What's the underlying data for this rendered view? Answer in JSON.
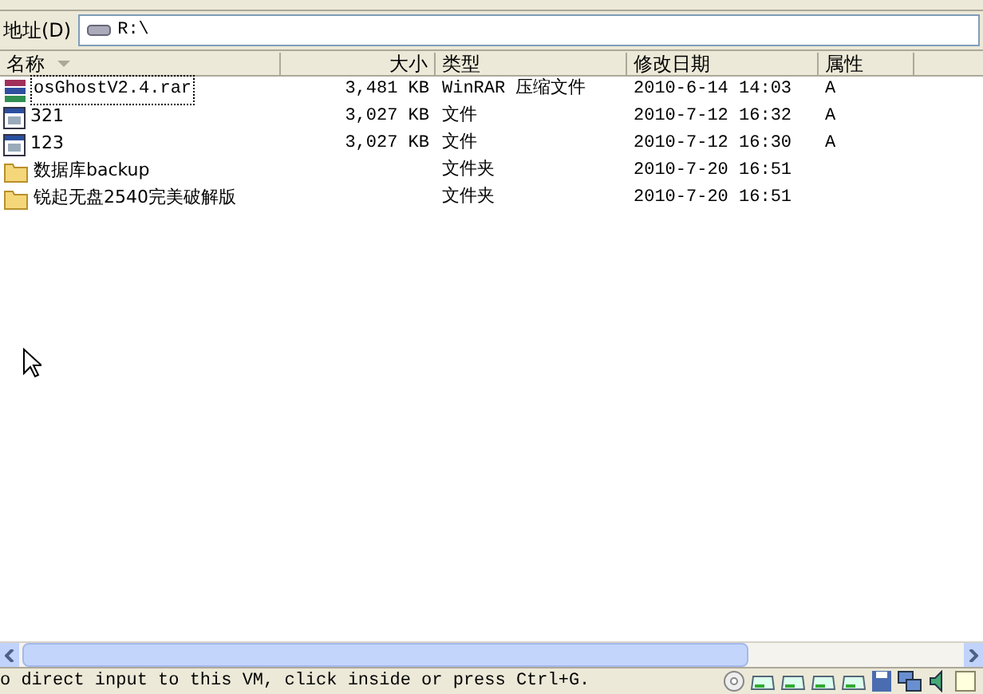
{
  "address_bar": {
    "label": "地址(D)",
    "value": "R:\\"
  },
  "columns": [
    {
      "label": "名称",
      "sorted": true
    },
    {
      "label": "大小",
      "sorted": false
    },
    {
      "label": "类型",
      "sorted": false
    },
    {
      "label": "修改日期",
      "sorted": false
    },
    {
      "label": "属性",
      "sorted": false
    }
  ],
  "rows": [
    {
      "kind": "archive",
      "focused": true,
      "name": "osGhostV2.4.rar",
      "size": "3,481 KB",
      "type": "WinRAR 压缩文件",
      "modified": "2010-6-14 14:03",
      "attributes": "A"
    },
    {
      "kind": "file",
      "focused": false,
      "name": "321",
      "size": "3,027 KB",
      "type": "文件",
      "modified": "2010-7-12 16:32",
      "attributes": "A"
    },
    {
      "kind": "file",
      "focused": false,
      "name": "123",
      "size": "3,027 KB",
      "type": "文件",
      "modified": "2010-7-12 16:30",
      "attributes": "A"
    },
    {
      "kind": "folder",
      "focused": false,
      "name": "数据库backup",
      "type": "文件夹",
      "modified": "2010-7-20 16:51"
    },
    {
      "kind": "folder",
      "focused": false,
      "name": "锐起无盘2540完美破解版",
      "type": "文件夹",
      "modified": "2010-7-20 16:51"
    }
  ],
  "status_bar": {
    "message": "o direct input to this VM, click inside or press Ctrl+G."
  }
}
